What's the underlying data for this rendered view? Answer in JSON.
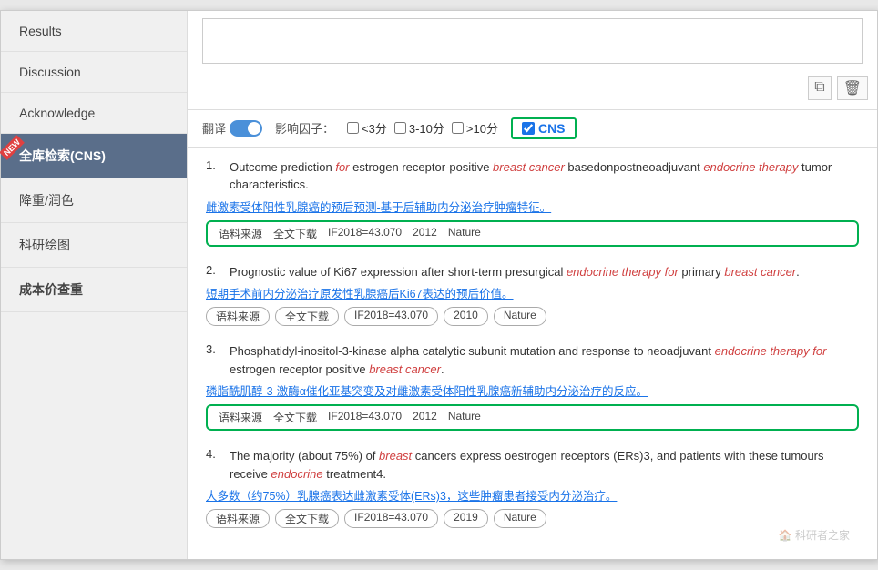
{
  "sidebar": {
    "items": [
      {
        "id": "results",
        "label": "Results",
        "active": false,
        "bold": false,
        "new": false
      },
      {
        "id": "discussion",
        "label": "Discussion",
        "active": false,
        "bold": false,
        "new": false
      },
      {
        "id": "acknowledge",
        "label": "Acknowledge",
        "active": false,
        "bold": false,
        "new": false
      },
      {
        "id": "full-search",
        "label": "全库检索(CNS)",
        "active": true,
        "bold": false,
        "new": true
      },
      {
        "id": "reduce-color",
        "label": "降重/润色",
        "active": false,
        "bold": false,
        "new": false
      },
      {
        "id": "research-draw",
        "label": "科研绘图",
        "active": false,
        "bold": false,
        "new": false
      },
      {
        "id": "cost-check",
        "label": "成本价查重",
        "active": false,
        "bold": true,
        "new": false
      }
    ]
  },
  "filter": {
    "translate_label": "翻译",
    "impact_label": "影响因子：",
    "option1": "<3分",
    "option2": "3-10分",
    "option3": ">10分",
    "cns_label": "CNS"
  },
  "toolbar": {
    "copy_icon": "⧉",
    "delete_icon": "🗑"
  },
  "results": [
    {
      "num": 1,
      "title_parts": [
        {
          "text": "Outcome prediction ",
          "style": "normal"
        },
        {
          "text": "for",
          "style": "italic-red"
        },
        {
          "text": " estrogen receptor-positive ",
          "style": "normal"
        },
        {
          "text": "breast cancer",
          "style": "italic-red"
        },
        {
          "text": " basedonpostneoadjuvant ",
          "style": "normal"
        },
        {
          "text": "endocrine therapy",
          "style": "italic-red"
        },
        {
          "text": " tumor characteristics.",
          "style": "normal"
        }
      ],
      "translation": "雌激素受体阳性乳腺癌的预后预测-基于后辅助内分泌治疗肿瘤特征。",
      "tags_highlighted": true,
      "tags": [
        "语料来源",
        "全文下载",
        "IF2018=43.070",
        "2012",
        "Nature"
      ]
    },
    {
      "num": 2,
      "title_parts": [
        {
          "text": "Prognostic value of Ki67 expression after short-term presurgical ",
          "style": "normal"
        },
        {
          "text": "endocrine therapy for",
          "style": "italic-red"
        },
        {
          "text": " primary ",
          "style": "normal"
        },
        {
          "text": "breast cancer",
          "style": "italic-red"
        },
        {
          "text": ".",
          "style": "normal"
        }
      ],
      "translation": "短期手术前内分泌治疗原发性乳腺癌后Ki67表达的预后价值。",
      "tags_highlighted": false,
      "tags": [
        "语料来源",
        "全文下载",
        "IF2018=43.070",
        "2010",
        "Nature"
      ]
    },
    {
      "num": 3,
      "title_parts": [
        {
          "text": "Phosphatidyl-inositol-3-kinase alpha catalytic subunit mutation and response to neoadjuvant ",
          "style": "normal"
        },
        {
          "text": "endocrine therapy for",
          "style": "italic-red"
        },
        {
          "text": " estrogen receptor positive ",
          "style": "normal"
        },
        {
          "text": "breast cancer",
          "style": "italic-red"
        },
        {
          "text": ".",
          "style": "normal"
        }
      ],
      "translation": "磷脂酰肌醇-3-激酶α催化亚基突变及对雌激素受体阳性乳腺癌新辅助内分泌治疗的反应。",
      "tags_highlighted": true,
      "tags": [
        "语料来源",
        "全文下载",
        "IF2018=43.070",
        "2012",
        "Nature"
      ]
    },
    {
      "num": 4,
      "title_parts": [
        {
          "text": "The majority (about 75%) of ",
          "style": "normal"
        },
        {
          "text": "breast",
          "style": "italic-red"
        },
        {
          "text": " cancers express oestrogen receptors (ERs)3, and patients with these tumours receive ",
          "style": "normal"
        },
        {
          "text": "endocrine",
          "style": "italic-red"
        },
        {
          "text": " treatment4.",
          "style": "normal"
        }
      ],
      "translation": "大多数（约75%）乳腺癌表达雌激素受体(ERs)3，这些肿瘤患者接受内分泌治疗。",
      "tags_highlighted": false,
      "tags": [
        "语料来源",
        "全文下载",
        "IF2018=43.070",
        "2019",
        "Nature"
      ]
    }
  ],
  "watermark": "科研者之家"
}
